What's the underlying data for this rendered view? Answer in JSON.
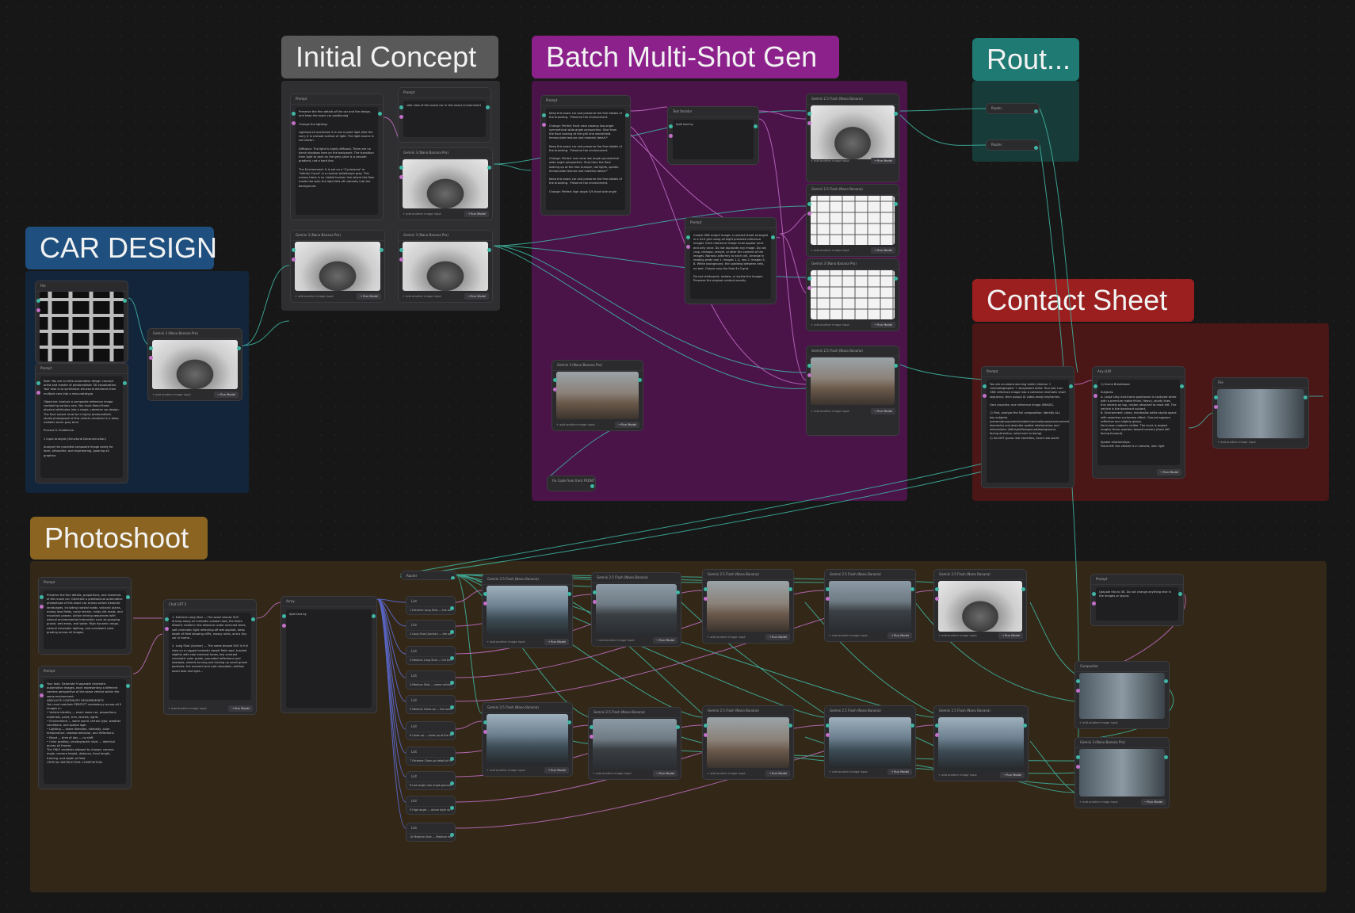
{
  "groups": {
    "car_design": {
      "title": "CAR DESIGN",
      "color": "#1e4f7e",
      "bg": "#13253a"
    },
    "initial_concept": {
      "title": "Initial Concept",
      "color": "#595959",
      "bg": "#2f2f31"
    },
    "batch": {
      "title": "Batch Multi-Shot Gen",
      "color": "#8c218c",
      "bg": "#4a1449"
    },
    "router": {
      "title": "Rout...",
      "color": "#1e7a72",
      "bg": "#173b39"
    },
    "contact_sheet": {
      "title": "Contact Sheet",
      "color": "#9b1f1f",
      "bg": "#4b1616"
    },
    "photoshoot": {
      "title": "Photoshoot",
      "color": "#8a6420",
      "bg": "#332817"
    }
  },
  "labels": {
    "file": "File",
    "prompt": "Prompt",
    "gemini3": "Gemini 3 (Nano Banana Pro)",
    "gemini25": "Gemini 2.5 Flash (Nano Banana)",
    "text_iterator": "Text Iterator",
    "router": "Router",
    "any_llm": "Any LLM",
    "chat_gpt": "Chat GPT 5",
    "array": "Array",
    "list": "List",
    "compositor": "Compositor",
    "add_image": "+ add another image input",
    "run": "→ Run Model",
    "split_by": "Split text by",
    "fix_node": "Fix Code from front FRONT"
  },
  "texts": {
    "car_prompt": "Role: You are an elite automotive design concept artist and master of photorealistic 3D visualization. Your task is to synthesize structural elements from multiple cars into a new prototype.\n\nObjective: Analyze a composite reference image containing various cars. You must blend these physical attributes into a single, cohesive car design. The final output must be a highly photorealistic studio photograph of this vehicle rendered in a deep metallic warm gray tone.\n\nProcess & Guidelines:\n\n1 Input Analysis (Structural Deconstruction)\n\nAnalyze the provided composite image solely for form, silhouette, and engineering, ignoring all graphics.",
    "ic_prompt1": "Preserve the fine details of the car and the design, and keep the exact car positioning\n\nChange the lighting:\n\nLightsource overhead: It is not a point light (like the sun); it is a broad surface of light. The light source is not shown.\n\nDiffusion: The light is highly diffused. There are no harsh shadows here on the bodywork. The transition from light to dark on the grey paint is a smooth gradient, not a hard line.\n\nThe Environment: It is set on a \"Cyclorama\" or \"Infinity Curve\" in a neutral slate/taupe grey. This means there is no visible horizon line where the floor meets the wall; the light falls off naturally into the background.",
    "ic_prompt2": "side view of this exact car in this exact environment",
    "batch_prompt": "Keep this exact car and preserve the fine details of the branding.  Preserve the environment.\n\nChange: Perfect front view closeup low-angle symmetrical wide-angle perspective. Shot from the floor looking at the grill and windshield. Immaculate texture and material detail.*\n\nKeep this exact car and preserve the fine details of the branding.  Preserve the environment.\n\nChange: Perfect rear view low angle symmetrical wide angle perspective. Shot from the floor looking up at the rear bumper, tail lights, spoiler. Immaculate texture and material detail.*\n\nKeep this exact car and preserve the fine details of the branding.  Preserve the environment.\n\nChange: Perfect high angle 3/4 front side angle",
    "grid_prompt": "Create ONE output image: a contact sheet arranged in a 4×3 grid using all eight provided reference images. Each reference image must appear once and only once. Do not duplicate any image. Do not crop, reshape, restyle, or alter the content of the images. Narrow uniformly to each cell. Arrange in reading order row 1: images 1–4, row 2: images 5–8. White background, thin padding between cells, no text. Output only the final 4×3 grid.\n\nDo not reinterpret, redraw, or stylize the images. Preserve the original content exactly.",
    "cs_prompt": "You are an award-winning trailer director + cinematographer + storyboard artist. Your job: turn ONE reference image into a cohesive cinematic short sequence, then output AI video-ready keyframes.\n\nUser provides: one reference image (IMAGE).\n\n1) First, analyze the full composition: identify ALL key subjects (person/group/vehicle/object/animal/props/environment elements) and describe spatial relationships and interactions (left/right/foreground/background, facing direction, what each is doing).\n2) Do NOT guess real identities, exact real-world",
    "llm_output": "1) Scene Breakdown\n\nSubjects:\nA. Large silky mid-frame positioned in textured white with a premium matte finish. Heavy, sturdy lines, thin wheels on top, rubber attached to most left. The vehicle is the dominant subject.\nB. Environment: clean, minimalist white studio space with seamless cyclorama effect. Ground appears reflective and slightly glossy.\nNo human subjects visible. The truck is angled roughly three quarters toward camera (front left facing forward).\n\nSpatial relationships:\nFront left: the vehicle is in camera, rear right",
    "ps_prompt1": "Preserve the fine details, proportions, and materials of this exact car. Generate a professional automotive photoshoot of this exact car across varied Icelandic landscapes, including coastal roads, volcanic plains, mossy lava fields, rocky terrain, misty dirt roads, and mountain passes. Action driving sequences with natural environmental interaction such as spraying gravel, wet areas, and water. High dynamic range, natural cinematic lighting, and consistent color grading across all images.",
    "ps_prompt2": "Your task: Generate 9 separate cinematic automotive images, each representing a different camera perspective of the same vehicle within the same environment.\nABSOLUTE CONTINUITY REQUIREMENTS\nYou must maintain PERFECT consistency across all 9 images in:\n• Vehicle identity — exact same car, proportions, materials, paint, trim, wheels, lights\n• Environment — same world, terrain type, weather conditions, and spatial logic\n• Lighting — same direction, intensity, color temperature, shadow behavior, and reflections\n• Mood — time of day — no shift\n• Color grading / photographic style — identical across all frames\nThe ONLY variables allowed to change: camera angle, camera height, distance, focal length, framing, and depth of field.\nCRITICAL INSTRUCTION: COMPOSITION",
    "gpt_output": "1. Extreme Long Shot — The same bronze SUV driving along an Icelandic coastal road; the North Atlantic visible in the distance under overcast skies, soft cinematic light reflecting off wet asphalt, deep depth of field showing cliffs, mossy rocks, and a tiny car in frame...\n\n2. Long Shot (Anchor) — The same bronze SUV in full view on a rugged Icelandic basalt field road, tracked slightly with cool overcast tones, low contrast cinematic color grade, grounded reflections and shadows, wheels turning and kicking up small gravel particles; the moment and cold relaxation; defines exact look and light...",
    "upscale_prompt": "Upscale this to 3K. Do not change anything else in the images or layout.",
    "list_items": [
      "1 Extreme Long Shot — the same…",
      "2 Long Shot (Anchor) — the sa…",
      "3 Medium Long Shot — full thre…",
      "4 Medium Shot — same vehicle…",
      "5 Medium Close-up — the same…",
      "6 Close-up — close-up of the fro…",
      "7 Extreme Close-up detail of th…",
      "8 Low angle rear angle ground…",
      "9 High angle — drone style sh…",
      "10 Medium Shot — Medium shot…"
    ]
  },
  "colors": {
    "wire_teal": "#3fb7a5",
    "wire_pink": "#c46fc8",
    "wire_blue": "#5f6fe0"
  }
}
